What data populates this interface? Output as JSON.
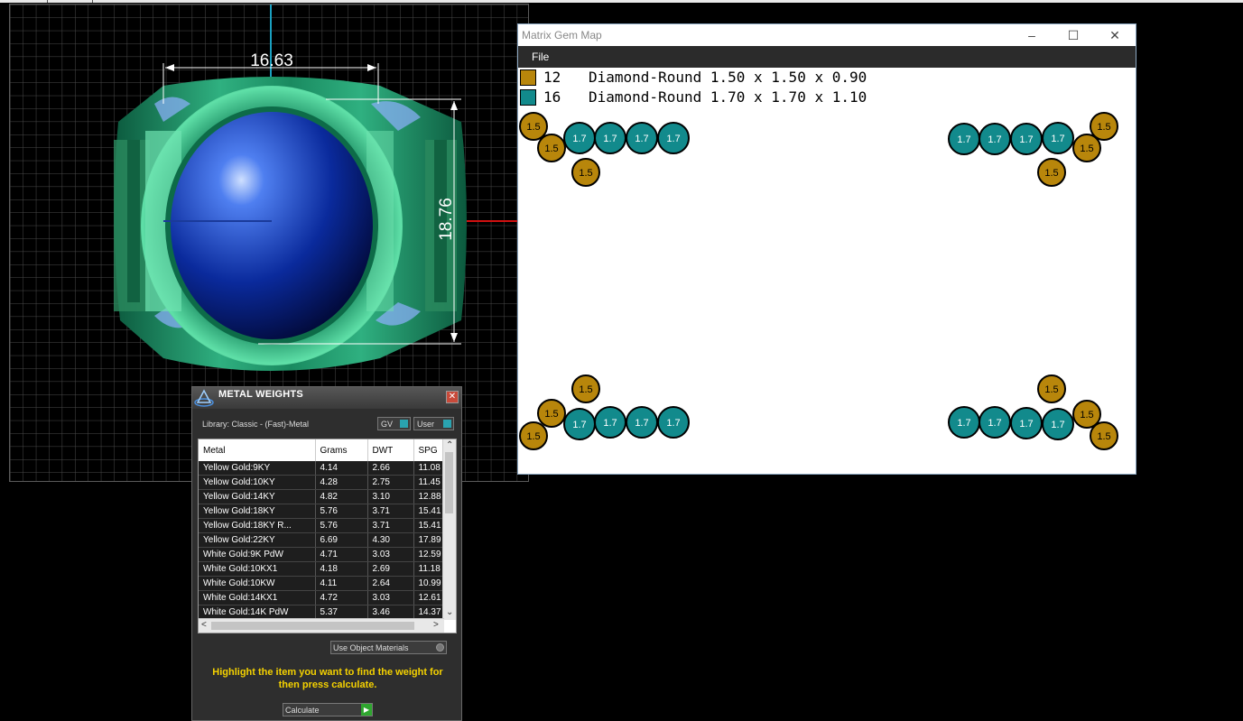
{
  "viewport": {
    "dim_width": "16.63",
    "dim_height": "18.76"
  },
  "gem_map": {
    "title": "Matrix Gem Map",
    "menu_file": "File",
    "legend": [
      {
        "count": "12",
        "desc": "Diamond-Round 1.50 x 1.50 x 0.90",
        "color": "#b8860b"
      },
      {
        "count": "16",
        "desc": "Diamond-Round 1.70 x 1.70 x 1.10",
        "color": "#128a8c"
      }
    ],
    "gem_label_small": "1.5",
    "gem_label_large": "1.7",
    "colors": {
      "small": "#b8860b",
      "large": "#128a8c"
    }
  },
  "metal_weights": {
    "title": "METAL WEIGHTS",
    "library": "Library: Classic - (Fast)-Metal",
    "gv_label": "GV",
    "user_label": "User",
    "columns": [
      "Metal",
      "Grams",
      "DWT",
      "SPG"
    ],
    "rows": [
      [
        "Yellow Gold:9KY",
        "4.14",
        "2.66",
        "11.08"
      ],
      [
        "Yellow Gold:10KY",
        "4.28",
        "2.75",
        "11.45"
      ],
      [
        "Yellow Gold:14KY",
        "4.82",
        "3.10",
        "12.88"
      ],
      [
        "Yellow Gold:18KY",
        "5.76",
        "3.71",
        "15.41"
      ],
      [
        "Yellow Gold:18KY R...",
        "5.76",
        "3.71",
        "15.41"
      ],
      [
        "Yellow Gold:22KY",
        "6.69",
        "4.30",
        "17.89"
      ],
      [
        "White Gold:9K PdW",
        "4.71",
        "3.03",
        "12.59"
      ],
      [
        "White Gold:10KX1",
        "4.18",
        "2.69",
        "11.18"
      ],
      [
        "White Gold:10KW",
        "4.11",
        "2.64",
        "10.99"
      ],
      [
        "White Gold:14KX1",
        "4.72",
        "3.03",
        "12.61"
      ],
      [
        "White Gold:14K PdW",
        "5.37",
        "3.46",
        "14.37"
      ]
    ],
    "use_object_materials": "Use Object Materials",
    "hint": "Highlight the item you want to find the weight for then press calculate.",
    "calculate": "Calculate"
  }
}
